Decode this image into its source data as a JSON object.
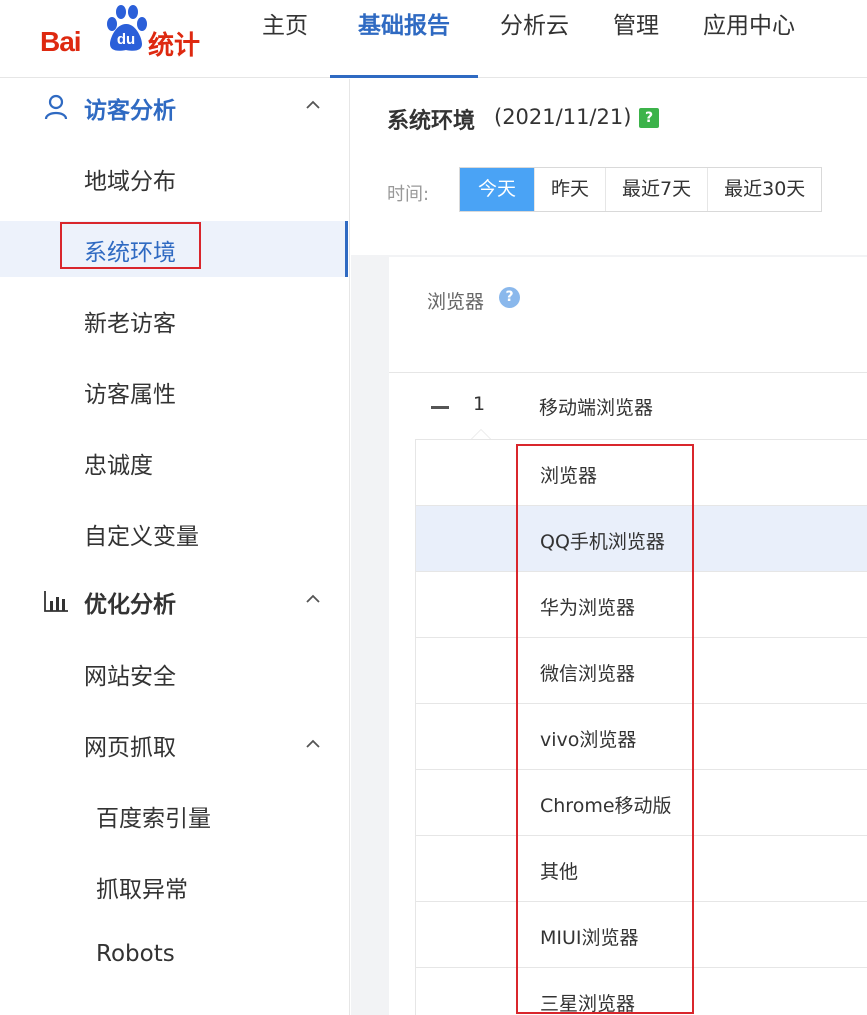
{
  "logo": {
    "bai": "Bai",
    "du": "du",
    "tongji": "统计"
  },
  "nav": {
    "items": [
      {
        "label": "主页",
        "active": false
      },
      {
        "label": "基础报告",
        "active": true
      },
      {
        "label": "分析云",
        "active": false
      },
      {
        "label": "管理",
        "active": false
      },
      {
        "label": "应用中心",
        "active": false
      }
    ]
  },
  "sidebar": {
    "group_visitor": {
      "label": "访客分析",
      "icon": "user-icon"
    },
    "visitor_items": [
      "地域分布",
      "系统环境",
      "新老访客",
      "访客属性",
      "忠诚度",
      "自定义变量"
    ],
    "group_optimize": {
      "label": "优化分析",
      "icon": "bar-chart-icon"
    },
    "optimize_items": [
      "网站安全",
      "网页抓取"
    ],
    "crawl_items": [
      "百度索引量",
      "抓取异常",
      "Robots"
    ],
    "active_item": "系统环境"
  },
  "main": {
    "title": "系统环境",
    "date": "(2021/11/21)",
    "help": "?",
    "time_label": "时间:",
    "time_tabs": [
      "今天",
      "昨天",
      "最近7天",
      "最近30天"
    ],
    "active_tab": "今天",
    "column_header": "浏览器",
    "group_row": {
      "index": "1",
      "name": "移动端浏览器"
    },
    "sub_rows": [
      "浏览器",
      "QQ手机浏览器",
      "华为浏览器",
      "微信浏览器",
      "vivo浏览器",
      "Chrome移动版",
      "其他",
      "MIUI浏览器",
      "三星浏览器"
    ]
  },
  "colors": {
    "accent": "#2f6ac2",
    "brand_red": "#de2910",
    "highlight_box": "#d9262c",
    "tab_active": "#4aa3f5"
  }
}
